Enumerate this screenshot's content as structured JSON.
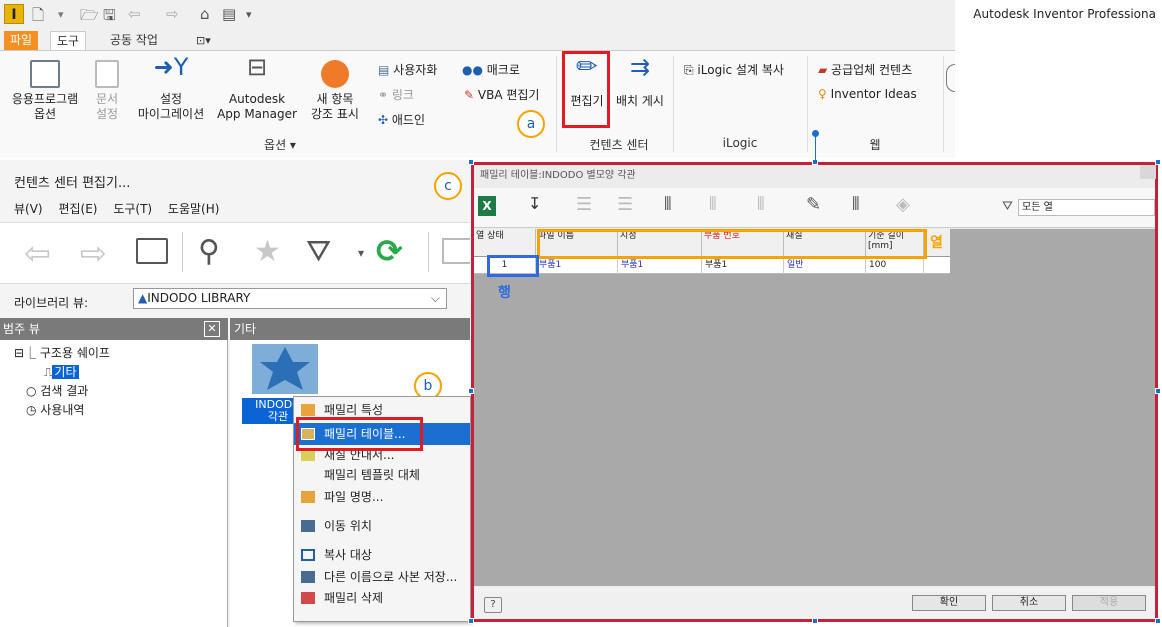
{
  "ribbon": {
    "app_title": "Autodesk Inventor Professiona",
    "tabs": {
      "file": "파일",
      "tools": "도구",
      "collab": "공동 작업"
    },
    "buttons": {
      "app_options_1": "응용프로그램",
      "app_options_2": "옵션",
      "doc_settings_1": "문서",
      "doc_settings_2": "설정",
      "migration_1": "설정",
      "migration_2": "마이그레이션",
      "appmanager_1": "Autodesk",
      "appmanager_2": "App Manager",
      "highlight_1": "새 항목",
      "highlight_2": "강조 표시",
      "customize": "사용자화",
      "link": "링크",
      "addin": "애드인",
      "macro": "매크로",
      "vba": "VBA 편집기",
      "editor": "편집기",
      "publish": "배치 게시",
      "ilogic_copy": "iLogic 설계 복사",
      "vendor": "공급업체 컨텐츠",
      "ideas": "Inventor Ideas"
    },
    "panels": {
      "options": "옵션 ▾",
      "content_center": "컨텐츠 센터",
      "ilogic": "iLogic",
      "web": "웹"
    }
  },
  "annotations": {
    "a": "a",
    "b": "b",
    "c": "c",
    "yeol": "열",
    "haeng": "행"
  },
  "content_center": {
    "title": "컨텐츠 센터 편집기...",
    "menu": {
      "view": "뷰(V)",
      "edit": "편집(E)",
      "tools": "도구(T)",
      "help": "도움말(H)"
    },
    "library_label": "라이브러리 뷰:",
    "library_value": "INDODO LIBRARY",
    "category_header": "범주 뷰",
    "close_glyph": "✕",
    "tree": {
      "structural": "구조용 쉐이프",
      "other": "기타",
      "search": "검색 결과",
      "history": "사용내역"
    },
    "item_header": "기타",
    "item_label_1": "INDODO",
    "item_label_2": "각관"
  },
  "context_menu": {
    "items": [
      "패밀리 특성",
      "패밀리 테이블...",
      "재질 안내서...",
      "패밀리 템플릿 대체",
      "파일 명명...",
      "이동 위치",
      "복사 대상",
      "다른 이름으로 사본 저장...",
      "패밀리 삭제"
    ]
  },
  "family_table": {
    "title": "패밀리 테이블:INDODO 별모양 각관",
    "filter_value": "모든 열",
    "headers": [
      "열 상태",
      "파일 이름",
      "지정",
      "부품 번호",
      "재질",
      "기준 길이 [mm]"
    ],
    "row": [
      "1",
      "부품1",
      "부품1",
      "부품1",
      "일반",
      "100"
    ],
    "ok": "확인",
    "cancel": "취소",
    "apply": "적용",
    "help": "?"
  },
  "colors": {
    "highlight_red": "#e01b24",
    "annotation_orange": "#f5a300",
    "annotation_blue": "#2f6bde",
    "selection_blue": "#1a6fd1"
  }
}
